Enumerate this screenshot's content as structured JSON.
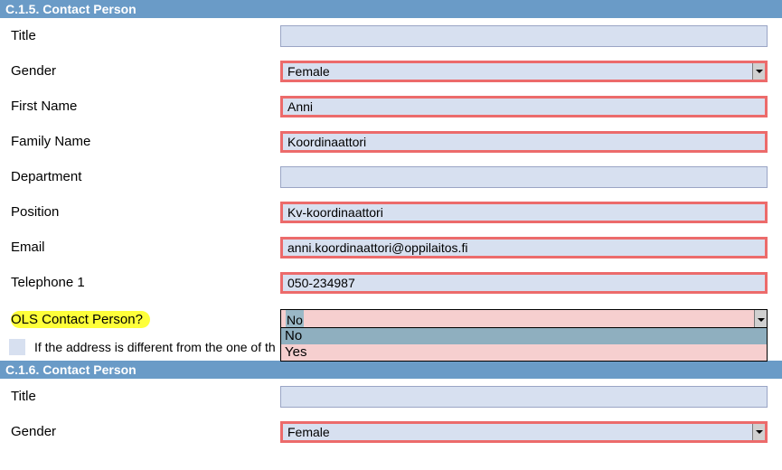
{
  "sections": {
    "c15": {
      "header": "C.1.5. Contact Person",
      "fields": {
        "title_label": "Title",
        "title_value": "",
        "gender_label": "Gender",
        "gender_value": "Female",
        "first_name_label": "First Name",
        "first_name_value": "Anni",
        "family_name_label": "Family Name",
        "family_name_value": "Koordinaattori",
        "department_label": "Department",
        "department_value": "",
        "position_label": "Position",
        "position_value": "Kv-koordinaattori",
        "email_label": "Email",
        "email_value": "anni.koordinaattori@oppilaitos.fi",
        "telephone1_label": "Telephone 1",
        "telephone1_value": "050-234987",
        "ols_label": "OLS Contact Person?",
        "ols_value": "No",
        "ols_options": {
          "no": "No",
          "yes": "Yes"
        }
      },
      "address_diff_label": "If the address is different from the one of th"
    },
    "c16": {
      "header": "C.1.6. Contact Person",
      "fields": {
        "title_label": "Title",
        "title_value": "",
        "gender_label": "Gender",
        "gender_value": "Female"
      }
    }
  }
}
